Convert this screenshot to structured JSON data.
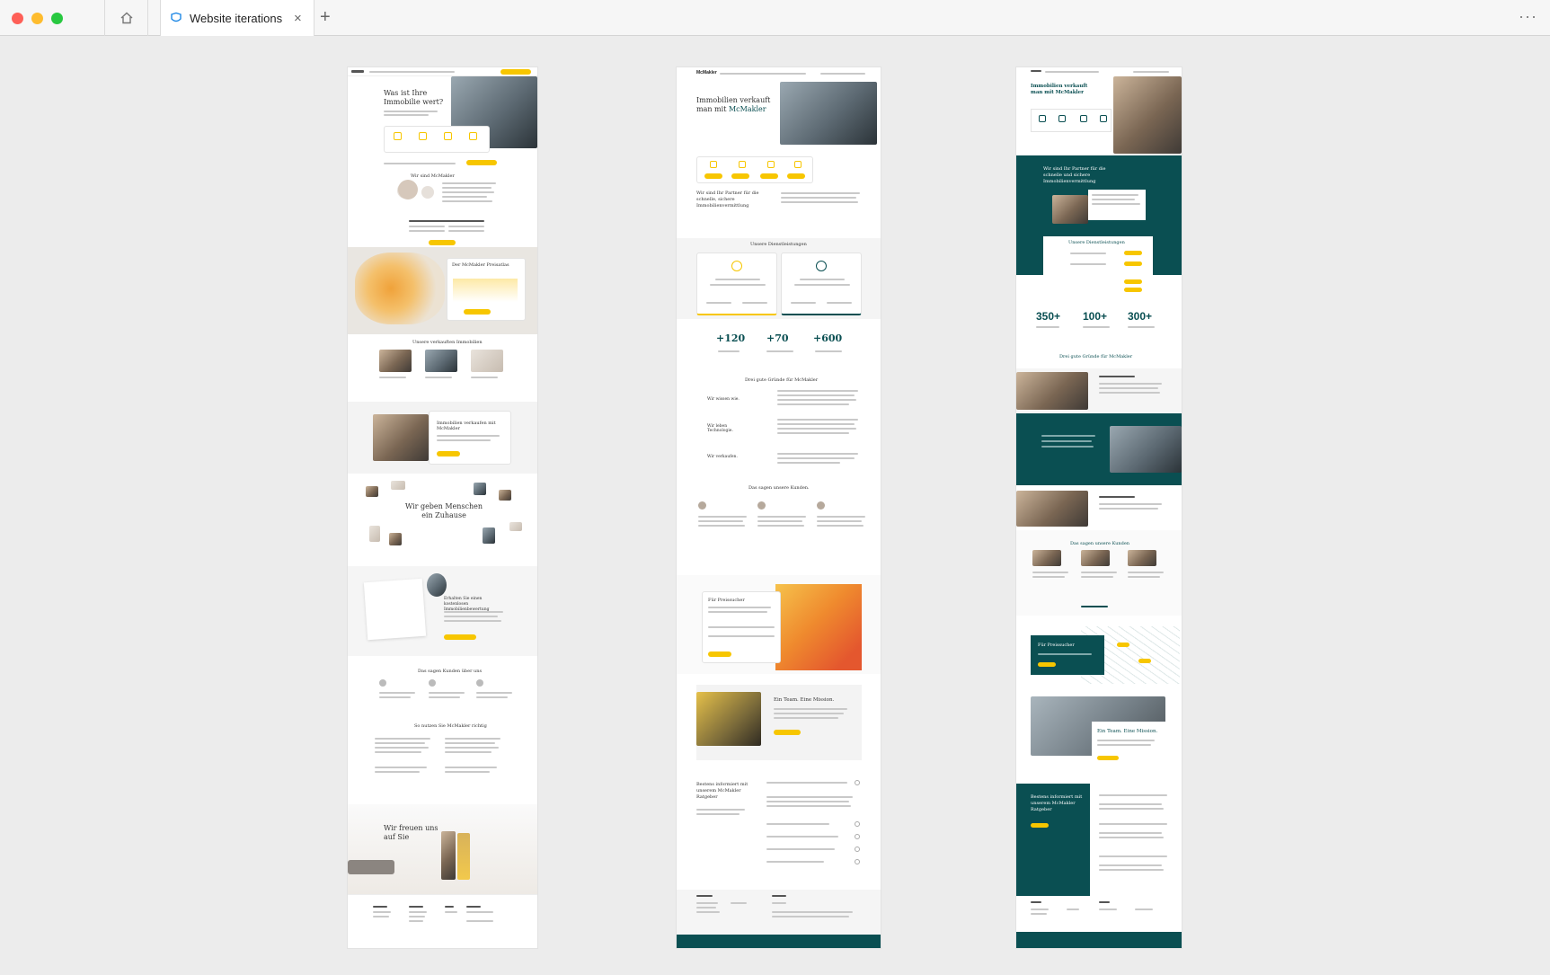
{
  "browser": {
    "tab_title": "Website iterations",
    "new_tab": "+",
    "more": "···"
  },
  "colors": {
    "accent_yellow": "#f7c600",
    "teal": "#0a4f52",
    "map_orange": "#f0a23a"
  },
  "v1": {
    "hero_title": "Was ist Ihre Immobilie wert?",
    "about_title": "Wir sind McMakler",
    "price_title": "Der McMakler Preisatlas",
    "sold_title": "Unsere verkauften Immobilien",
    "sell_title": "Immobilien verkaufen mit McMakler",
    "homes_title": "Wir geben Menschen ein Zuhause",
    "guide_title": "Erhalten Sie einen kostenlosen Immobilienbewertung",
    "reviews_title": "Das sagen Kunden über uns",
    "faq_title": "So nutzen Sie McMakler richtig",
    "closing_title": "Wir freuen uns auf Sie"
  },
  "v2": {
    "logo": "McMakler",
    "hero_title": "Immobilien verkauft man mit",
    "hero_brand": "McMakler",
    "partner_title": "Wir sind Ihr Partner für die schnelle, sichere Immobilienvermittlung",
    "services_title": "Unsere Dienstleistungen",
    "stats": [
      "+120",
      "+70",
      "+600"
    ],
    "reasons_title": "Drei gute Gründe für McMakler",
    "reasons": [
      "Wir wissen wie.",
      "Wir leben Technologie.",
      "Wir verkaufen."
    ],
    "reviews_title": "Das sagen unsere Kunden.",
    "price_title": "Für Preissucher",
    "team_title": "Ein Team. Eine Mission.",
    "advice_title": "Bestens informiert mit unserem McMakler Ratgeber"
  },
  "v3": {
    "hero_title": "Immobilien verkauft man mit McMakler",
    "partner_title": "Wir sind Ihr Partner für die schnelle und sichere Immobilienvermittlung",
    "services_title": "Unsere Dienstleistungen",
    "stats": [
      "350+",
      "100+",
      "300+"
    ],
    "reasons_title": "Drei gute Gründe für McMakler",
    "reviews_title": "Das sagen unsere Kunden",
    "price_title": "Für Preissucher",
    "team_title": "Ein Team. Eine Mission.",
    "advice_title": "Bestens informiert mit unserem McMakler Ratgeber"
  }
}
